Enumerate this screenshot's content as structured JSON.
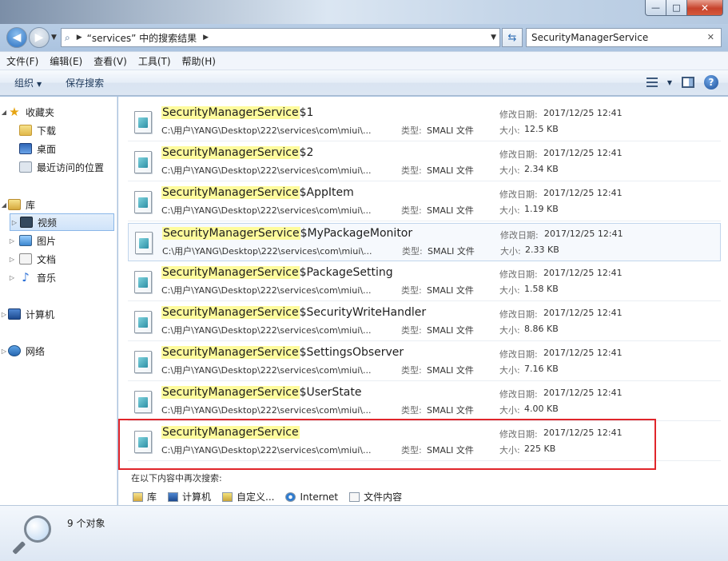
{
  "window": {
    "min_label": "—",
    "max_label": "□",
    "close_label": "✕"
  },
  "address": {
    "segments": [
      "“services” 中的搜索结果"
    ]
  },
  "search": {
    "value": "SecurityManagerService"
  },
  "menu": [
    "文件(F)",
    "编辑(E)",
    "查看(V)",
    "工具(T)",
    "帮助(H)"
  ],
  "toolbar": {
    "organize": "组织",
    "save_search": "保存搜索"
  },
  "sidebar": {
    "favorites": "收藏夹",
    "downloads": "下载",
    "desktop": "桌面",
    "recent": "最近访问的位置",
    "libraries": "库",
    "videos": "视频",
    "pictures": "图片",
    "documents": "文档",
    "music": "音乐",
    "computer": "计算机",
    "network": "网络"
  },
  "labels": {
    "type": "类型:",
    "modified": "修改日期:",
    "size": "大小:"
  },
  "results": [
    {
      "highlight": "SecurityManagerService",
      "suffix": "$1",
      "path": "C:\\用户\\YANG\\Desktop\\222\\services\\com\\miui\\...",
      "type": "SMALI 文件",
      "date": "2017/12/25 12:41",
      "size": "12.5 KB"
    },
    {
      "highlight": "SecurityManagerService",
      "suffix": "$2",
      "path": "C:\\用户\\YANG\\Desktop\\222\\services\\com\\miui\\...",
      "type": "SMALI 文件",
      "date": "2017/12/25 12:41",
      "size": "2.34 KB"
    },
    {
      "highlight": "SecurityManagerService",
      "suffix": "$AppItem",
      "path": "C:\\用户\\YANG\\Desktop\\222\\services\\com\\miui\\...",
      "type": "SMALI 文件",
      "date": "2017/12/25 12:41",
      "size": "1.19 KB"
    },
    {
      "highlight": "SecurityManagerService",
      "suffix": "$MyPackageMonitor",
      "path": "C:\\用户\\YANG\\Desktop\\222\\services\\com\\miui\\...",
      "type": "SMALI 文件",
      "date": "2017/12/25 12:41",
      "size": "2.33 KB"
    },
    {
      "highlight": "SecurityManagerService",
      "suffix": "$PackageSetting",
      "path": "C:\\用户\\YANG\\Desktop\\222\\services\\com\\miui\\...",
      "type": "SMALI 文件",
      "date": "2017/12/25 12:41",
      "size": "1.58 KB"
    },
    {
      "highlight": "SecurityManagerService",
      "suffix": "$SecurityWriteHandler",
      "path": "C:\\用户\\YANG\\Desktop\\222\\services\\com\\miui\\...",
      "type": "SMALI 文件",
      "date": "2017/12/25 12:41",
      "size": "8.86 KB"
    },
    {
      "highlight": "SecurityManagerService",
      "suffix": "$SettingsObserver",
      "path": "C:\\用户\\YANG\\Desktop\\222\\services\\com\\miui\\...",
      "type": "SMALI 文件",
      "date": "2017/12/25 12:41",
      "size": "7.16 KB"
    },
    {
      "highlight": "SecurityManagerService",
      "suffix": "$UserState",
      "path": "C:\\用户\\YANG\\Desktop\\222\\services\\com\\miui\\...",
      "type": "SMALI 文件",
      "date": "2017/12/25 12:41",
      "size": "4.00 KB"
    },
    {
      "highlight": "SecurityManagerService",
      "suffix": "",
      "path": "C:\\用户\\YANG\\Desktop\\222\\services\\com\\miui\\...",
      "type": "SMALI 文件",
      "date": "2017/12/25 12:41",
      "size": "225 KB"
    }
  ],
  "search_again": {
    "label": "在以下内容中再次搜索:",
    "library": "库",
    "computer": "计算机",
    "custom": "自定义...",
    "internet": "Internet",
    "file_contents": "文件内容"
  },
  "status": {
    "count": "9 个对象"
  },
  "colors": {
    "highlight": "#fefb9c",
    "annotation_box": "#e0262b"
  }
}
